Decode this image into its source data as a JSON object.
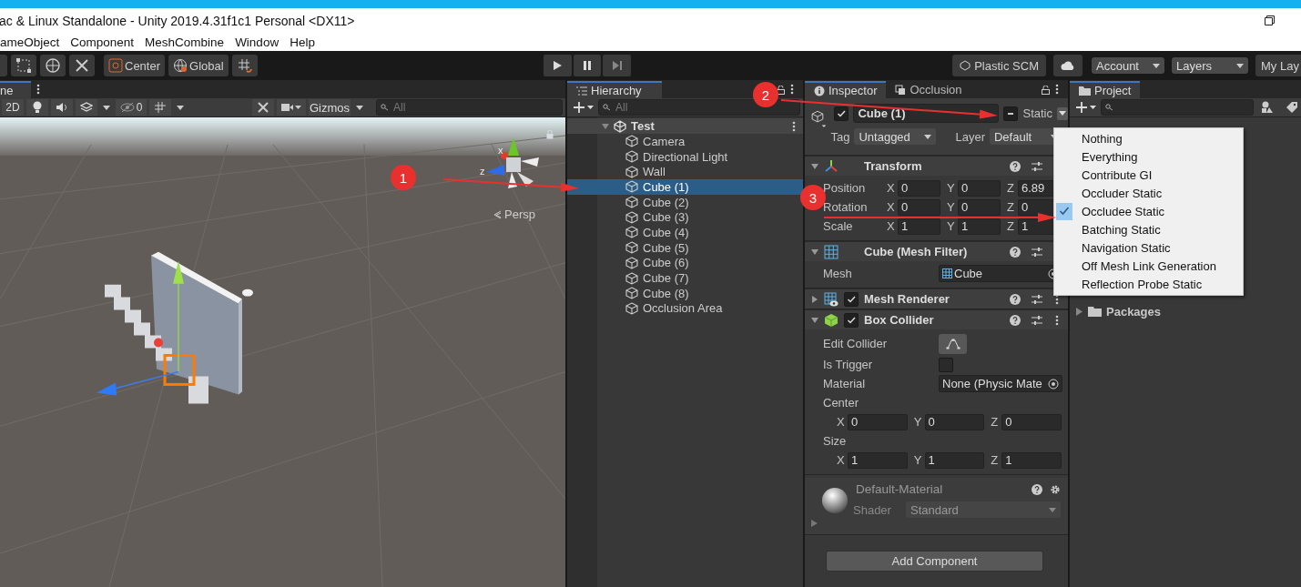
{
  "window": {
    "title": "ac & Linux Standalone - Unity 2019.4.31f1c1 Personal <DX11>"
  },
  "menu": [
    "ameObject",
    "Component",
    "MeshCombine",
    "Window",
    "Help"
  ],
  "toolbar": {
    "pivot": "Center",
    "space": "Global",
    "source_control": "Plastic SCM",
    "account": "Account",
    "layers": "Layers",
    "layout": "My Lay"
  },
  "scene": {
    "tab": "ne",
    "mode_2d": "2D",
    "hidden_count": "0",
    "gizmos": "Gizmos",
    "search_placeholder": "All",
    "view_label": "Persp",
    "axis_labels": [
      "x",
      "z"
    ]
  },
  "hierarchy": {
    "tab": "Hierarchy",
    "search_placeholder": "All",
    "scene": "Test",
    "items": [
      {
        "name": "Camera",
        "selected": false
      },
      {
        "name": "Directional Light",
        "selected": false
      },
      {
        "name": "Wall",
        "selected": false
      },
      {
        "name": "Cube (1)",
        "selected": true
      },
      {
        "name": "Cube (2)",
        "selected": false
      },
      {
        "name": "Cube (3)",
        "selected": false
      },
      {
        "name": "Cube (4)",
        "selected": false
      },
      {
        "name": "Cube (5)",
        "selected": false
      },
      {
        "name": "Cube (6)",
        "selected": false
      },
      {
        "name": "Cube (7)",
        "selected": false
      },
      {
        "name": "Cube (8)",
        "selected": false
      },
      {
        "name": "Occlusion Area",
        "selected": false
      }
    ]
  },
  "inspector": {
    "tabs": [
      {
        "label": "Inspector",
        "selected": true
      },
      {
        "label": "Occlusion",
        "selected": false
      }
    ],
    "object": {
      "active": true,
      "name": "Cube (1)",
      "static_mixed": true,
      "static_label": "Static",
      "tag_label": "Tag",
      "tag": "Untagged",
      "layer_label": "Layer",
      "layer": "Default"
    },
    "components": [
      {
        "kind": "transform",
        "title": "Transform",
        "expanded": true,
        "rows": [
          {
            "kind": "vector",
            "label": "Position",
            "values": [
              {
                "axis": "X",
                "value": "0"
              },
              {
                "axis": "Y",
                "value": "0"
              },
              {
                "axis": "Z",
                "value": "6.89"
              }
            ]
          },
          {
            "kind": "vector",
            "label": "Rotation",
            "values": [
              {
                "axis": "X",
                "value": "0"
              },
              {
                "axis": "Y",
                "value": "0"
              },
              {
                "axis": "Z",
                "value": "0"
              }
            ]
          },
          {
            "kind": "vector",
            "label": "Scale",
            "values": [
              {
                "axis": "X",
                "value": "1"
              },
              {
                "axis": "Y",
                "value": "1"
              },
              {
                "axis": "Z",
                "value": "1"
              }
            ]
          }
        ]
      },
      {
        "kind": "mesh_filter",
        "title": "Cube (Mesh Filter)",
        "expanded": true,
        "rows": [
          {
            "kind": "object",
            "label": "Mesh",
            "value": "Cube",
            "asset": true
          }
        ]
      },
      {
        "kind": "mesh_renderer",
        "title": "Mesh Renderer",
        "expanded": false,
        "enabled": true
      },
      {
        "kind": "collider",
        "title": "Box Collider",
        "expanded": true,
        "enabled": true,
        "rows": [
          {
            "kind": "button",
            "label": "Edit Collider"
          },
          {
            "kind": "checkbox",
            "label": "Is Trigger",
            "checked": false
          },
          {
            "kind": "object",
            "label": "Material",
            "value": "None (Physic Mate",
            "asset": false
          },
          {
            "kind": "heading",
            "label": "Center"
          },
          {
            "kind": "vector",
            "values": [
              {
                "axis": "X",
                "value": "0"
              },
              {
                "axis": "Y",
                "value": "0"
              },
              {
                "axis": "Z",
                "value": "0"
              }
            ]
          },
          {
            "kind": "heading",
            "label": "Size"
          },
          {
            "kind": "vector",
            "values": [
              {
                "axis": "X",
                "value": "1"
              },
              {
                "axis": "Y",
                "value": "1"
              },
              {
                "axis": "Z",
                "value": "1"
              }
            ]
          }
        ]
      }
    ],
    "material": {
      "name": "Default-Material",
      "shader_label": "Shader",
      "shader": "Standard"
    },
    "add_button": "Add Component"
  },
  "static_menu": [
    {
      "label": "Nothing",
      "selected": false
    },
    {
      "label": "Everything",
      "selected": false
    },
    {
      "label": "Contribute GI",
      "selected": false
    },
    {
      "label": "Occluder Static",
      "selected": false
    },
    {
      "label": "Occludee Static",
      "selected": true
    },
    {
      "label": "Batching Static",
      "selected": false
    },
    {
      "label": "Navigation Static",
      "selected": false
    },
    {
      "label": "Off Mesh Link Generation",
      "selected": false
    },
    {
      "label": "Reflection Probe Static",
      "selected": false
    }
  ],
  "project": {
    "tab": "Project",
    "folders": [
      {
        "name": "Packages",
        "expanded": false
      }
    ]
  },
  "annotations": [
    {
      "number": "1"
    },
    {
      "number": "2"
    },
    {
      "number": "3"
    }
  ]
}
